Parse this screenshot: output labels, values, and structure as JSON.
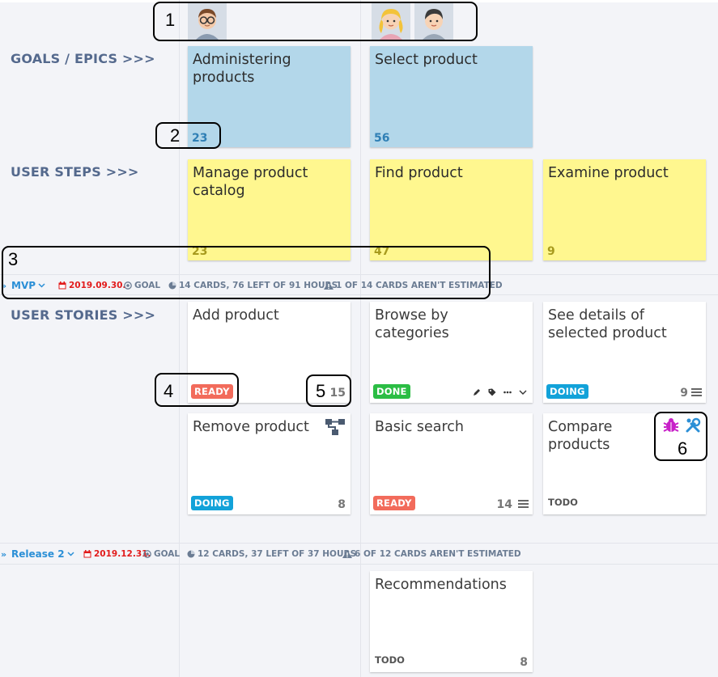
{
  "avatars": [
    {
      "name": "avatar-man-glasses"
    },
    {
      "name": "avatar-woman-blonde"
    },
    {
      "name": "avatar-man-dark-hair"
    }
  ],
  "row_labels": {
    "goals": "GOALS / EPICS >>>",
    "steps": "USER STEPS >>>",
    "stories": "USER STORIES >>>"
  },
  "goals": [
    {
      "title": "Administering products",
      "count": "23"
    },
    {
      "title": "Select product",
      "count": "56"
    }
  ],
  "steps": [
    {
      "title": "Manage product catalog",
      "count": "23"
    },
    {
      "title": "Find product",
      "count": "47"
    },
    {
      "title": "Examine product",
      "count": "9"
    }
  ],
  "release_mvp": {
    "name": "MVP",
    "date": "2019.09.30.",
    "goal": "GOAL",
    "cards": "14 CARDS, 76 LEFT OF 91 HOURS",
    "warning": "1 OF 14 CARDS AREN'T ESTIMATED"
  },
  "release_2": {
    "name": "Release 2",
    "date": "2019.12.31.",
    "goal": "GOAL",
    "cards": "12 CARDS, 37 LEFT OF 37 HOURS",
    "warning": "6 OF 12 CARDS AREN'T ESTIMATED"
  },
  "stories": {
    "add_product": {
      "title": "Add product",
      "status": "READY",
      "estimate": "15"
    },
    "browse": {
      "title": "Browse by categories",
      "status": "DONE"
    },
    "see_details": {
      "title": "See details of selected product",
      "status": "DOING",
      "estimate": "9"
    },
    "remove_product": {
      "title": "Remove product",
      "status": "DOING",
      "estimate": "8"
    },
    "basic_search": {
      "title": "Basic search",
      "status": "READY",
      "estimate": "14"
    },
    "compare": {
      "title": "Compare products",
      "status": "TODO"
    },
    "recommendations": {
      "title": "Recommendations",
      "status": "TODO",
      "estimate": "8"
    }
  },
  "annotations": [
    "1",
    "2",
    "3",
    "4",
    "5",
    "6"
  ],
  "colors": {
    "goal_card": "#b3d7ea",
    "step_card": "#fff78f",
    "ready": "#f26b5b",
    "done": "#2bbd44",
    "doing": "#12a2d9",
    "release_link": "#2b8fd6",
    "date_red": "#e21b1b"
  },
  "icons": [
    "chevron-down-icon",
    "calendar-icon",
    "target-icon",
    "pie-chart-icon",
    "warning-icon",
    "pencil-icon",
    "tag-icon",
    "more-icon",
    "list-icon",
    "hierarchy-icon",
    "bug-icon",
    "tools-icon"
  ]
}
